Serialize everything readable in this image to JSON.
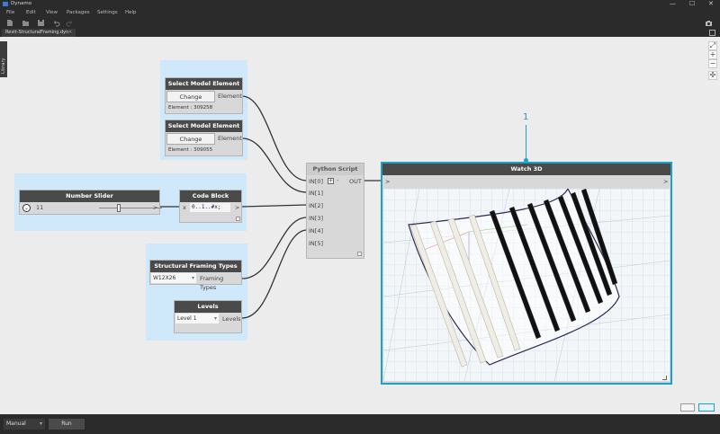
{
  "app": {
    "title": "Dynamo",
    "minimize": "—",
    "maximize": "☐",
    "close": "✕"
  },
  "menu": [
    "File",
    "Edit",
    "View",
    "Packages",
    "Settings",
    "Help"
  ],
  "tab": {
    "label": "Revit-StructuralFraming.dyn",
    "close": "✕"
  },
  "library": {
    "label": "Library"
  },
  "zoom": {
    "fit": "⤢",
    "in": "+",
    "out": "−",
    "pan": "✣"
  },
  "callout": "1",
  "nodes": {
    "select1": {
      "title": "Select Model Element",
      "button": "Change",
      "output": "Element",
      "value": "Element : 309258"
    },
    "select2": {
      "title": "Select Model Element",
      "button": "Change",
      "output": "Element",
      "value": "Element : 309055"
    },
    "slider": {
      "title": "Number Slider",
      "value": "11",
      "output": ">"
    },
    "codeblock": {
      "title": "Code Block",
      "input": "x",
      "code": "0..1..#x;",
      "output": ">"
    },
    "framing": {
      "title": "Structural Framing Types",
      "selected": "W12X26",
      "output": "Framing Types"
    },
    "levels": {
      "title": "Levels",
      "selected": "Level 1",
      "output": "Levels"
    },
    "python": {
      "title": "Python Script",
      "inputs": [
        "IN[0]",
        "IN[1]",
        "IN[2]",
        "IN[3]",
        "IN[4]",
        "IN[5]"
      ],
      "add": "+",
      "remove": "-",
      "output": "OUT"
    },
    "watch3d": {
      "title": "Watch 3D",
      "input": ">",
      "output": ">"
    }
  },
  "run": {
    "mode": "Manual",
    "button": "Run"
  },
  "colors": {
    "accent": "#1ba1c5",
    "group": "#cfe8fa",
    "header": "#4a4a4a",
    "chrome": "#2b2b2b"
  }
}
